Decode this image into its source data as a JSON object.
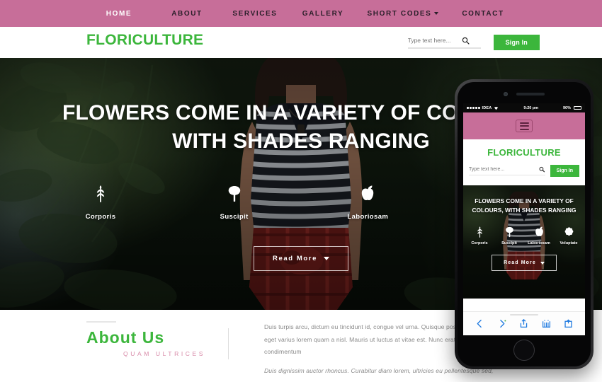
{
  "topnav": {
    "items": [
      {
        "label": "HOME",
        "active": true,
        "caret": false
      },
      {
        "label": "ABOUT",
        "active": false,
        "caret": false
      },
      {
        "label": "SERVICES",
        "active": false,
        "caret": false
      },
      {
        "label": "GALLERY",
        "active": false,
        "caret": false
      },
      {
        "label": "SHORT CODES",
        "active": false,
        "caret": true
      },
      {
        "label": "CONTACT",
        "active": false,
        "caret": false
      }
    ],
    "bg_color": "#c76e99"
  },
  "header": {
    "logo": "FLORICULTURE",
    "logo_color": "#3cb63c",
    "search_placeholder": "Type text here...",
    "search_value": "",
    "signin_label": "Sign In",
    "signin_color": "#3cb63c"
  },
  "hero": {
    "title_line1": "FLOWERS COME IN A VARIETY OF COLOURS,",
    "title_line2": "WITH SHADES RANGING",
    "icons": [
      {
        "label": "Corporis",
        "icon": "wheat-icon"
      },
      {
        "label": "Suscipit",
        "icon": "tree-icon"
      },
      {
        "label": "Laboriosam",
        "icon": "apple-icon"
      },
      {
        "label": "Voluptate",
        "icon": "flower-icon"
      }
    ],
    "read_more": "Read More"
  },
  "about": {
    "title": "About Us",
    "subtitle": "QUAM ULTRICES",
    "title_color": "#3cb63c",
    "subtitle_color": "#d88aa8",
    "paragraph": "Duis turpis arcu, dictum eu tincidunt id, congue vel urna. Quisque posuere cursus, ex tortor elementum leo, eget varius lorem quam a nisl. Mauris ut luctus at vitae est. Nunc erat odio, blandit eget nisl ac, laoreet condimentum",
    "paragraph_em": "Duis dignissim auctor rhoncus. Curabitur diam lorem, ultricies eu pellentesque sed,"
  },
  "phone": {
    "status": {
      "carrier": "IDEA",
      "time": "9:20 pm",
      "battery": "90%"
    },
    "menu_icon": "hamburger-icon",
    "logo": "FLORICULTURE",
    "search_placeholder": "Type text here...",
    "signin_label": "Sign In",
    "hero_title_line1": "FLOWERS COME IN A VARIETY OF",
    "hero_title_line2": "COLOURS, WITH SHADES RANGING",
    "icons": [
      {
        "label": "Corporis",
        "icon": "wheat-icon"
      },
      {
        "label": "Suscipit",
        "icon": "tree-icon"
      },
      {
        "label": "Laboriosam",
        "icon": "apple-icon"
      },
      {
        "label": "Voluptate",
        "icon": "flower-icon"
      }
    ],
    "read_more": "Read More"
  }
}
